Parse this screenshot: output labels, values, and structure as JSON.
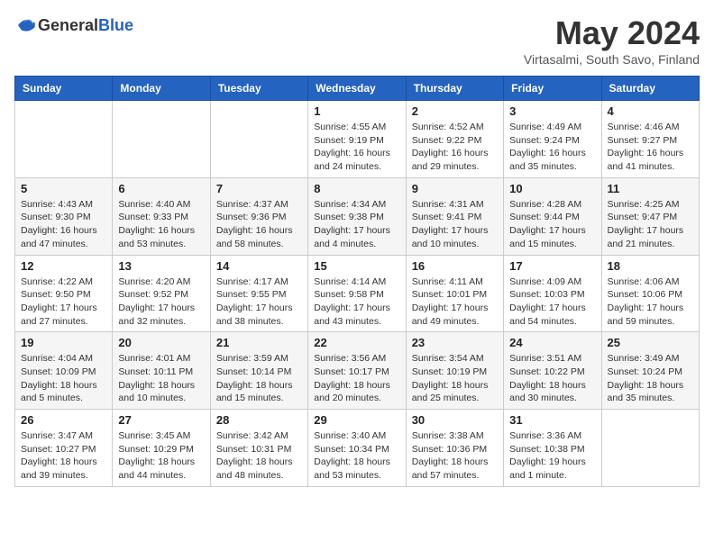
{
  "header": {
    "logo_general": "General",
    "logo_blue": "Blue",
    "month_title": "May 2024",
    "location": "Virtasalmi, South Savo, Finland"
  },
  "days_of_week": [
    "Sunday",
    "Monday",
    "Tuesday",
    "Wednesday",
    "Thursday",
    "Friday",
    "Saturday"
  ],
  "weeks": [
    [
      {
        "day": "",
        "info": ""
      },
      {
        "day": "",
        "info": ""
      },
      {
        "day": "",
        "info": ""
      },
      {
        "day": "1",
        "info": "Sunrise: 4:55 AM\nSunset: 9:19 PM\nDaylight: 16 hours and 24 minutes."
      },
      {
        "day": "2",
        "info": "Sunrise: 4:52 AM\nSunset: 9:22 PM\nDaylight: 16 hours and 29 minutes."
      },
      {
        "day": "3",
        "info": "Sunrise: 4:49 AM\nSunset: 9:24 PM\nDaylight: 16 hours and 35 minutes."
      },
      {
        "day": "4",
        "info": "Sunrise: 4:46 AM\nSunset: 9:27 PM\nDaylight: 16 hours and 41 minutes."
      }
    ],
    [
      {
        "day": "5",
        "info": "Sunrise: 4:43 AM\nSunset: 9:30 PM\nDaylight: 16 hours and 47 minutes."
      },
      {
        "day": "6",
        "info": "Sunrise: 4:40 AM\nSunset: 9:33 PM\nDaylight: 16 hours and 53 minutes."
      },
      {
        "day": "7",
        "info": "Sunrise: 4:37 AM\nSunset: 9:36 PM\nDaylight: 16 hours and 58 minutes."
      },
      {
        "day": "8",
        "info": "Sunrise: 4:34 AM\nSunset: 9:38 PM\nDaylight: 17 hours and 4 minutes."
      },
      {
        "day": "9",
        "info": "Sunrise: 4:31 AM\nSunset: 9:41 PM\nDaylight: 17 hours and 10 minutes."
      },
      {
        "day": "10",
        "info": "Sunrise: 4:28 AM\nSunset: 9:44 PM\nDaylight: 17 hours and 15 minutes."
      },
      {
        "day": "11",
        "info": "Sunrise: 4:25 AM\nSunset: 9:47 PM\nDaylight: 17 hours and 21 minutes."
      }
    ],
    [
      {
        "day": "12",
        "info": "Sunrise: 4:22 AM\nSunset: 9:50 PM\nDaylight: 17 hours and 27 minutes."
      },
      {
        "day": "13",
        "info": "Sunrise: 4:20 AM\nSunset: 9:52 PM\nDaylight: 17 hours and 32 minutes."
      },
      {
        "day": "14",
        "info": "Sunrise: 4:17 AM\nSunset: 9:55 PM\nDaylight: 17 hours and 38 minutes."
      },
      {
        "day": "15",
        "info": "Sunrise: 4:14 AM\nSunset: 9:58 PM\nDaylight: 17 hours and 43 minutes."
      },
      {
        "day": "16",
        "info": "Sunrise: 4:11 AM\nSunset: 10:01 PM\nDaylight: 17 hours and 49 minutes."
      },
      {
        "day": "17",
        "info": "Sunrise: 4:09 AM\nSunset: 10:03 PM\nDaylight: 17 hours and 54 minutes."
      },
      {
        "day": "18",
        "info": "Sunrise: 4:06 AM\nSunset: 10:06 PM\nDaylight: 17 hours and 59 minutes."
      }
    ],
    [
      {
        "day": "19",
        "info": "Sunrise: 4:04 AM\nSunset: 10:09 PM\nDaylight: 18 hours and 5 minutes."
      },
      {
        "day": "20",
        "info": "Sunrise: 4:01 AM\nSunset: 10:11 PM\nDaylight: 18 hours and 10 minutes."
      },
      {
        "day": "21",
        "info": "Sunrise: 3:59 AM\nSunset: 10:14 PM\nDaylight: 18 hours and 15 minutes."
      },
      {
        "day": "22",
        "info": "Sunrise: 3:56 AM\nSunset: 10:17 PM\nDaylight: 18 hours and 20 minutes."
      },
      {
        "day": "23",
        "info": "Sunrise: 3:54 AM\nSunset: 10:19 PM\nDaylight: 18 hours and 25 minutes."
      },
      {
        "day": "24",
        "info": "Sunrise: 3:51 AM\nSunset: 10:22 PM\nDaylight: 18 hours and 30 minutes."
      },
      {
        "day": "25",
        "info": "Sunrise: 3:49 AM\nSunset: 10:24 PM\nDaylight: 18 hours and 35 minutes."
      }
    ],
    [
      {
        "day": "26",
        "info": "Sunrise: 3:47 AM\nSunset: 10:27 PM\nDaylight: 18 hours and 39 minutes."
      },
      {
        "day": "27",
        "info": "Sunrise: 3:45 AM\nSunset: 10:29 PM\nDaylight: 18 hours and 44 minutes."
      },
      {
        "day": "28",
        "info": "Sunrise: 3:42 AM\nSunset: 10:31 PM\nDaylight: 18 hours and 48 minutes."
      },
      {
        "day": "29",
        "info": "Sunrise: 3:40 AM\nSunset: 10:34 PM\nDaylight: 18 hours and 53 minutes."
      },
      {
        "day": "30",
        "info": "Sunrise: 3:38 AM\nSunset: 10:36 PM\nDaylight: 18 hours and 57 minutes."
      },
      {
        "day": "31",
        "info": "Sunrise: 3:36 AM\nSunset: 10:38 PM\nDaylight: 19 hours and 1 minute."
      },
      {
        "day": "",
        "info": ""
      }
    ]
  ]
}
